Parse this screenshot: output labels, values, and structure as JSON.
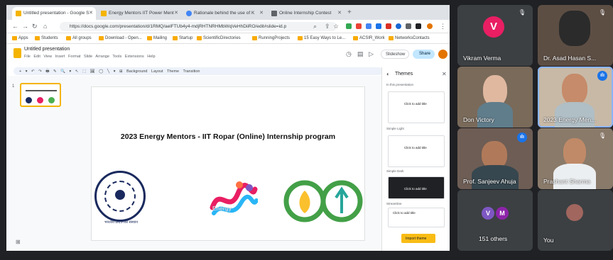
{
  "browser": {
    "tabs": [
      {
        "label": "Untitled presentation - Google S",
        "color": "#f4b400",
        "active": true
      },
      {
        "label": "Energy Mentors IIT Power Ment",
        "color": "#f4b400",
        "active": false
      },
      {
        "label": "Rationale behind the use of K",
        "color": "#4285f4",
        "active": false
      },
      {
        "label": "Online Internship Contest",
        "color": "#5f6368",
        "active": false
      }
    ],
    "new_tab": "+",
    "url": "https://docs.google.com/presentation/d/1RMQ/aelFTUb4y4-mdjRHTNRHMbWqVeHhDiiRO/edit#slide=id.p",
    "bookmarks": [
      "Apps",
      "Students",
      "All groups",
      "Download - Open...",
      "Mailing",
      "Startup",
      "ScientificDirectories",
      "RunningProjects",
      "15 Easy Ways to Le...",
      "ACSIR_Work",
      "NetworksContacts"
    ]
  },
  "slides": {
    "doc_title": "Untitled presentation",
    "menu": "File Edit View Insert Format Slide Arrange Tools Extensions Help",
    "slideshow_label": "Slideshow",
    "share_label": "Share",
    "toolbar": "+ ▾ ↶ ↷ 🖶 ✎ 🔍 ▾ ↖ ⬚ 🖼 ◯ ╲ ▾ ⊞ Background Layout Theme Transition",
    "slide_number": "1",
    "slide_title": "2023 Energy Mentors - IIT Ropar (Online) Internship program",
    "logo_caption": "भारतीय प्रौद्योगिकी संस्थान",
    "logo_text": "Energy",
    "themes": {
      "title": "Themes",
      "sections": [
        {
          "label": "In this presentation",
          "card_text": "Click to add title",
          "bg": "#ffffff",
          "fg": "#202124"
        },
        {
          "label": "Simple Light",
          "card_text": "Click to add title",
          "bg": "#ffffff",
          "fg": "#202124"
        },
        {
          "label": "Simple Dark",
          "card_text": "Click to add title",
          "bg": "#202124",
          "fg": "#ffffff"
        },
        {
          "label": "Streamline",
          "card_text": "Click to add title",
          "bg": "#ffffff",
          "fg": "#202124"
        },
        {
          "label": "Streamline",
          "card_text": "",
          "bg": "#ffffff",
          "fg": "#202124"
        }
      ],
      "import_label": "Import theme"
    }
  },
  "participants": [
    {
      "name": "Vikram Verma",
      "initial": "V",
      "avatar_color": "#e91e63",
      "muted": false
    },
    {
      "name": "Dr. Asad Hasan S...",
      "muted": true
    },
    {
      "name": "Don Victory",
      "muted": false
    },
    {
      "name": "2023 Energy Men...",
      "muted": false
    },
    {
      "name": "Prof. Sanjeev Ahuja",
      "muted": false
    },
    {
      "name": "Prashant Sharma",
      "muted": true
    },
    {
      "name": "151 others",
      "initials": [
        "V",
        "M"
      ],
      "avatar_colors": [
        "#7e57c2",
        "#8e24aa"
      ]
    },
    {
      "name": "You"
    }
  ],
  "colors": {
    "meet_bg": "#202124",
    "tile_bg": "#3c4043",
    "active_speaker": "#8ab4f8"
  }
}
